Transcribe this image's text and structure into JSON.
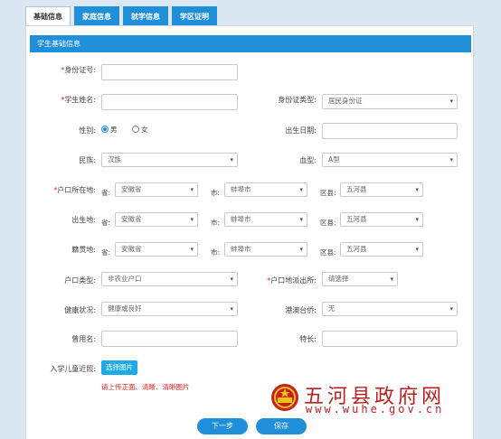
{
  "tabs": [
    "基础信息",
    "家庭信息",
    "就学信息",
    "学区证明"
  ],
  "panel_title": "学生基础信息",
  "fields": {
    "id_number": {
      "label": "身份证号:",
      "value": ""
    },
    "student_name": {
      "label": "学生姓名:",
      "value": ""
    },
    "id_type": {
      "label": "身份证类型:",
      "value": "居民身份证"
    },
    "gender": {
      "label": "性别:",
      "male": "男",
      "female": "女",
      "selected": "男"
    },
    "birth_date": {
      "label": "出生日期:",
      "value": ""
    },
    "ethnicity": {
      "label": "民族:",
      "value": "汉族"
    },
    "blood_type": {
      "label": "血型:",
      "value": "A型"
    },
    "hukou_location": {
      "label": "户口所在地:",
      "province": "安徽省",
      "city": "蚌埠市",
      "district": "五河县"
    },
    "birthplace": {
      "label": "出生地:",
      "province": "安徽省",
      "city": "蚌埠市",
      "district": "五河县"
    },
    "native_place": {
      "label": "籍贯地:",
      "province": "安徽省",
      "city": "蚌埠市",
      "district": "五河县"
    },
    "hukou_type": {
      "label": "户口类型:",
      "value": "非农业户口"
    },
    "police_station": {
      "label": "户口地派出所:",
      "value": "请选择"
    },
    "health": {
      "label": "健康状况:",
      "value": "健康或良好"
    },
    "overseas_chinese": {
      "label": "港澳台侨:",
      "value": "无"
    },
    "former_name": {
      "label": "曾用名:",
      "value": ""
    },
    "specialty": {
      "label": "特长:",
      "value": ""
    },
    "photo": {
      "label": "入学儿童近照:",
      "button": "选择图片",
      "hint": "请上传正面、清晰、清晰图片"
    }
  },
  "region_labels": {
    "province": "省:",
    "city": "市:",
    "district": "区县:"
  },
  "required_mark": "*",
  "buttons": {
    "next": "下一步",
    "save": "保存"
  },
  "watermark": {
    "title": "五河县政府网",
    "url": "www.wuhe.gov.cn"
  },
  "colors": {
    "accent": "#1e8fd8",
    "required": "#e02020",
    "watermark": "#b5211f"
  }
}
